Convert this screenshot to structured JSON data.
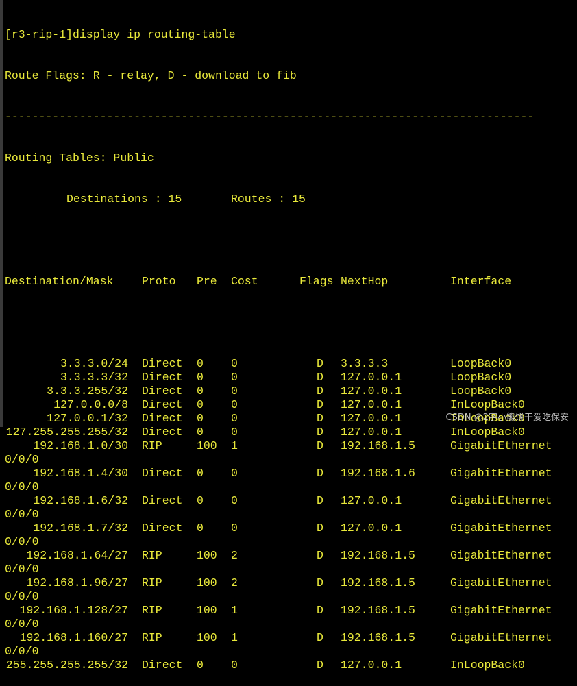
{
  "terminal": {
    "command_line": "[r3-rip-1]display ip routing-table",
    "route_flags": "Route Flags: R - relay, D - download to fib",
    "separator": "------------------------------------------------------------------------------",
    "routing_tables_label": "Routing Tables: Public",
    "destinations_label": "Destinations : 15",
    "routes_label": "Routes : 15",
    "headers": {
      "destination": "Destination/Mask",
      "proto": "Proto",
      "pre": "Pre",
      "cost": "Cost",
      "flags": "Flags",
      "nexthop": "NextHop",
      "interface": "Interface"
    },
    "routes": [
      {
        "dest": "3.3.3.0/24",
        "proto": "Direct",
        "pre": "0",
        "cost": "0",
        "flags": "D",
        "nexthop": "3.3.3.3",
        "iface": "LoopBack0",
        "iface_cont": ""
      },
      {
        "dest": "3.3.3.3/32",
        "proto": "Direct",
        "pre": "0",
        "cost": "0",
        "flags": "D",
        "nexthop": "127.0.0.1",
        "iface": "LoopBack0",
        "iface_cont": ""
      },
      {
        "dest": "3.3.3.255/32",
        "proto": "Direct",
        "pre": "0",
        "cost": "0",
        "flags": "D",
        "nexthop": "127.0.0.1",
        "iface": "LoopBack0",
        "iface_cont": ""
      },
      {
        "dest": "127.0.0.0/8",
        "proto": "Direct",
        "pre": "0",
        "cost": "0",
        "flags": "D",
        "nexthop": "127.0.0.1",
        "iface": "InLoopBack0",
        "iface_cont": ""
      },
      {
        "dest": "127.0.0.1/32",
        "proto": "Direct",
        "pre": "0",
        "cost": "0",
        "flags": "D",
        "nexthop": "127.0.0.1",
        "iface": "InLoopBack0",
        "iface_cont": ""
      },
      {
        "dest": "127.255.255.255/32",
        "proto": "Direct",
        "pre": "0",
        "cost": "0",
        "flags": "D",
        "nexthop": "127.0.0.1",
        "iface": "InLoopBack0",
        "iface_cont": ""
      },
      {
        "dest": "192.168.1.0/30",
        "proto": "RIP",
        "pre": "100",
        "cost": "1",
        "flags": "D",
        "nexthop": "192.168.1.5",
        "iface": "GigabitEthernet",
        "iface_cont": "0/0/0"
      },
      {
        "dest": "192.168.1.4/30",
        "proto": "Direct",
        "pre": "0",
        "cost": "0",
        "flags": "D",
        "nexthop": "192.168.1.6",
        "iface": "GigabitEthernet",
        "iface_cont": "0/0/0"
      },
      {
        "dest": "192.168.1.6/32",
        "proto": "Direct",
        "pre": "0",
        "cost": "0",
        "flags": "D",
        "nexthop": "127.0.0.1",
        "iface": "GigabitEthernet",
        "iface_cont": "0/0/0"
      },
      {
        "dest": "192.168.1.7/32",
        "proto": "Direct",
        "pre": "0",
        "cost": "0",
        "flags": "D",
        "nexthop": "127.0.0.1",
        "iface": "GigabitEthernet",
        "iface_cont": "0/0/0"
      },
      {
        "dest": "192.168.1.64/27",
        "proto": "RIP",
        "pre": "100",
        "cost": "2",
        "flags": "D",
        "nexthop": "192.168.1.5",
        "iface": "GigabitEthernet",
        "iface_cont": "0/0/0"
      },
      {
        "dest": "192.168.1.96/27",
        "proto": "RIP",
        "pre": "100",
        "cost": "2",
        "flags": "D",
        "nexthop": "192.168.1.5",
        "iface": "GigabitEthernet",
        "iface_cont": "0/0/0"
      },
      {
        "dest": "192.168.1.128/27",
        "proto": "RIP",
        "pre": "100",
        "cost": "1",
        "flags": "D",
        "nexthop": "192.168.1.5",
        "iface": "GigabitEthernet",
        "iface_cont": "0/0/0"
      },
      {
        "dest": "192.168.1.160/27",
        "proto": "RIP",
        "pre": "100",
        "cost": "1",
        "flags": "D",
        "nexthop": "192.168.1.5",
        "iface": "GigabitEthernet",
        "iface_cont": "0/0/0"
      },
      {
        "dest": "255.255.255.255/32",
        "proto": "Direct",
        "pre": "0",
        "cost": "0",
        "flags": "D",
        "nexthop": "127.0.0.1",
        "iface": "InLoopBack0",
        "iface_cont": ""
      }
    ]
  },
  "watermark": "CSDN @2字小熊饼干爱吃保安",
  "colors": {
    "background": "#000000",
    "text": "#e8e83a"
  }
}
